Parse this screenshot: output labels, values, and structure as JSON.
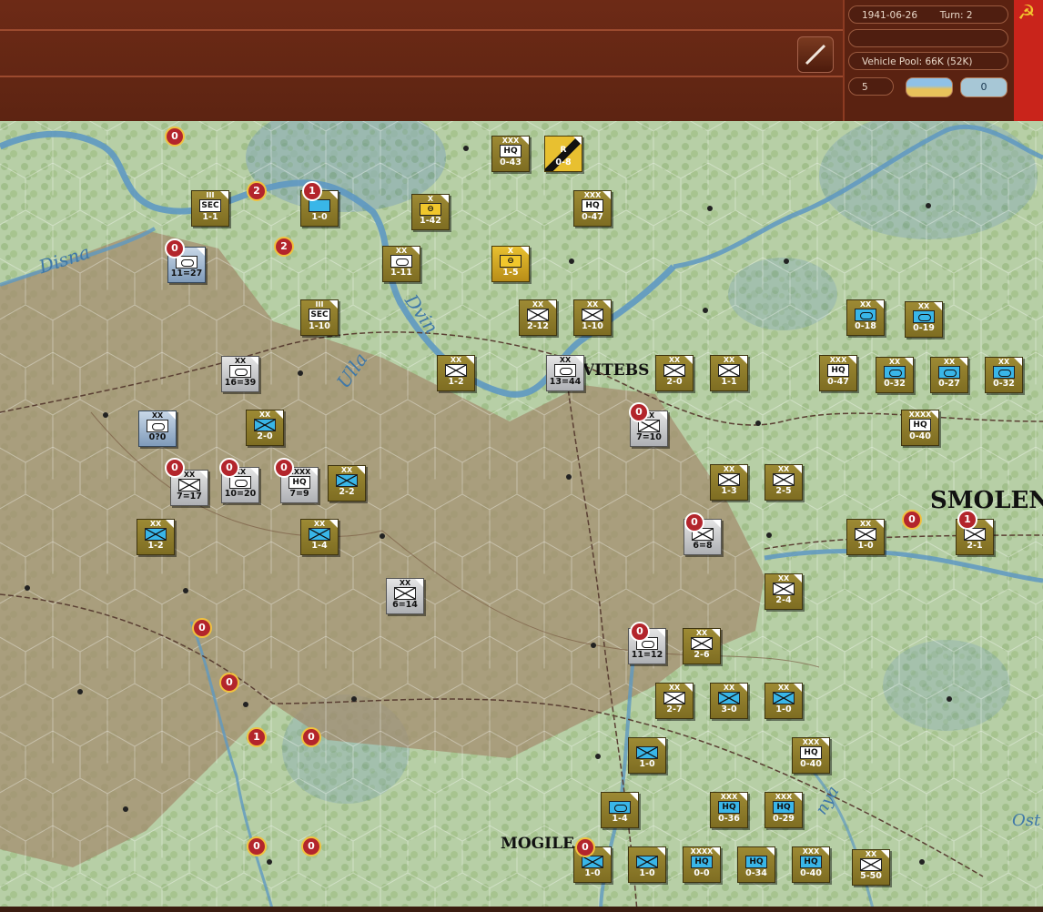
{
  "header": {
    "date": "1941-06-26",
    "turn": "Turn: 2",
    "vehicle_pool": "Vehicle Pool: 66K (52K)",
    "box_value": "5",
    "toggle": "0",
    "empty_field": ""
  },
  "cities": [
    {
      "name": "VITEBS"
    },
    {
      "name": "SMOLEN"
    },
    {
      "name": "MOGILE"
    }
  ],
  "rivers": [
    {
      "name": "Disna"
    },
    {
      "name": "Ulla"
    },
    {
      "name": "Dvin"
    },
    {
      "name": "nya"
    },
    {
      "name": "Ost"
    }
  ],
  "units": [
    {
      "id": "hq-043",
      "side": "sov",
      "ech": "XXX",
      "sym": "HQ",
      "val": "0-43"
    },
    {
      "id": "rail-08",
      "side": "rail",
      "ech": "",
      "sym": "R",
      "val": "0-8"
    },
    {
      "id": "sec-11",
      "side": "sov",
      "ech": "III",
      "sym": "SEC",
      "val": "1-1"
    },
    {
      "id": "tank-10",
      "side": "sov",
      "ech": "",
      "sym": "",
      "val": "1-0"
    },
    {
      "id": "cav-142",
      "side": "sov",
      "ech": "X",
      "sym": "",
      "val": "1-42"
    },
    {
      "id": "hq-047a",
      "side": "sov",
      "ech": "XXX",
      "sym": "HQ",
      "val": "0-47"
    },
    {
      "id": "ax-1127",
      "side": "sel",
      "ech": "",
      "sym": "",
      "val": "11=27"
    },
    {
      "id": "arm-111",
      "side": "sov",
      "ech": "XX",
      "sym": "",
      "val": "1-11"
    },
    {
      "id": "cav-15",
      "side": "yel",
      "ech": "X",
      "sym": "",
      "val": "1-5"
    },
    {
      "id": "sec-110",
      "side": "sov",
      "ech": "III",
      "sym": "SEC",
      "val": "1-10"
    },
    {
      "id": "inf-212",
      "side": "sov",
      "ech": "XX",
      "sym": "",
      "val": "2-12"
    },
    {
      "id": "inf-110",
      "side": "sov",
      "ech": "XX",
      "sym": "",
      "val": "1-10"
    },
    {
      "id": "mot-018",
      "side": "sov",
      "ech": "XX",
      "sym": "",
      "val": "0-18"
    },
    {
      "id": "mot-019",
      "side": "sov",
      "ech": "XX",
      "sym": "",
      "val": "0-19"
    },
    {
      "id": "ax-1639",
      "side": "gr",
      "ech": "XX",
      "sym": "",
      "val": "16=39"
    },
    {
      "id": "inf-12",
      "side": "sov",
      "ech": "XX",
      "sym": "",
      "val": "1-2"
    },
    {
      "id": "ax-1344",
      "side": "gr",
      "ech": "XX",
      "sym": "",
      "val": "13=44"
    },
    {
      "id": "inf-20a",
      "side": "sov",
      "ech": "XX",
      "sym": "",
      "val": "2-0"
    },
    {
      "id": "inf-11",
      "side": "sov",
      "ech": "XX",
      "sym": "",
      "val": "1-1"
    },
    {
      "id": "hq-047b",
      "side": "sov",
      "ech": "XXX",
      "sym": "HQ",
      "val": "0-47"
    },
    {
      "id": "mot-032a",
      "side": "sov",
      "ech": "XX",
      "sym": "",
      "val": "0-32"
    },
    {
      "id": "mot-027",
      "side": "sov",
      "ech": "XX",
      "sym": "",
      "val": "0-27"
    },
    {
      "id": "mot-032b",
      "side": "sov",
      "ech": "XX",
      "sym": "",
      "val": "0-32"
    },
    {
      "id": "ax-020",
      "side": "sel",
      "ech": "XX",
      "sym": "",
      "val": "0?0"
    },
    {
      "id": "inf-20b",
      "side": "sov",
      "ech": "XX",
      "sym": "",
      "val": "2-0"
    },
    {
      "id": "ax-710a",
      "side": "gr",
      "ech": "XX",
      "sym": "",
      "val": "7=10"
    },
    {
      "id": "hq-040a",
      "side": "sov",
      "ech": "XXXX",
      "sym": "HQ",
      "val": "0-40"
    },
    {
      "id": "ax-717",
      "side": "gr",
      "ech": "XX",
      "sym": "",
      "val": "7=17"
    },
    {
      "id": "ax-1020",
      "side": "gr",
      "ech": "XX",
      "sym": "",
      "val": "10=20"
    },
    {
      "id": "ax-79",
      "side": "gr",
      "ech": "XXXX",
      "sym": "HQ",
      "val": "7=9"
    },
    {
      "id": "inf-22",
      "side": "sov",
      "ech": "XX",
      "sym": "",
      "val": "2-2"
    },
    {
      "id": "inf-13",
      "side": "sov",
      "ech": "XX",
      "sym": "",
      "val": "1-3"
    },
    {
      "id": "inf-25",
      "side": "sov",
      "ech": "XX",
      "sym": "",
      "val": "2-5"
    },
    {
      "id": "inf-12b",
      "side": "sov",
      "ech": "XX",
      "sym": "",
      "val": "1-2"
    },
    {
      "id": "inf-14",
      "side": "sov",
      "ech": "XX",
      "sym": "",
      "val": "1-4"
    },
    {
      "id": "ax-68",
      "side": "gr",
      "ech": "",
      "sym": "",
      "val": "6=8"
    },
    {
      "id": "inf-10a",
      "side": "sov",
      "ech": "XX",
      "sym": "",
      "val": "1-0"
    },
    {
      "id": "city-21",
      "side": "sov",
      "ech": "",
      "sym": "",
      "val": "2-1"
    },
    {
      "id": "ax-614",
      "side": "gr",
      "ech": "XX",
      "sym": "",
      "val": "6=14"
    },
    {
      "id": "inf-24",
      "side": "sov",
      "ech": "XX",
      "sym": "",
      "val": "2-4"
    },
    {
      "id": "ax-1112",
      "side": "gr",
      "ech": "",
      "sym": "",
      "val": "11=12"
    },
    {
      "id": "inf-26",
      "side": "sov",
      "ech": "XX",
      "sym": "",
      "val": "2-6"
    },
    {
      "id": "inf-27",
      "side": "sov",
      "ech": "XX",
      "sym": "",
      "val": "2-7"
    },
    {
      "id": "inf-30",
      "side": "sov",
      "ech": "XX",
      "sym": "",
      "val": "3-0"
    },
    {
      "id": "inf-10b",
      "side": "sov",
      "ech": "XX",
      "sym": "",
      "val": "1-0"
    },
    {
      "id": "inf-10c",
      "side": "sov",
      "ech": "",
      "sym": "",
      "val": "1-0"
    },
    {
      "id": "hq-040b",
      "side": "sov",
      "ech": "XXX",
      "sym": "HQ",
      "val": "0-40"
    },
    {
      "id": "mot-14",
      "side": "sov",
      "ech": "",
      "sym": "",
      "val": "1-4"
    },
    {
      "id": "hq-036",
      "side": "sov",
      "ech": "XXX",
      "sym": "HQ",
      "val": "0-36"
    },
    {
      "id": "hq-029",
      "side": "sov",
      "ech": "XXX",
      "sym": "HQ",
      "val": "0-29"
    },
    {
      "id": "inf-10d",
      "side": "sov",
      "ech": "",
      "sym": "",
      "val": "1-0"
    },
    {
      "id": "inf-10e",
      "side": "sov",
      "ech": "",
      "sym": "",
      "val": "1-0"
    },
    {
      "id": "hq-00",
      "side": "sov",
      "ech": "XXXX",
      "sym": "HQ",
      "val": "0-0"
    },
    {
      "id": "hq-034",
      "side": "sov",
      "ech": "",
      "sym": "HQ",
      "val": "0-34"
    },
    {
      "id": "hq-040c",
      "side": "sov",
      "ech": "XXX",
      "sym": "HQ",
      "val": "0-40"
    },
    {
      "id": "inf-550",
      "side": "sov",
      "ech": "XX",
      "sym": "",
      "val": "5-50"
    }
  ],
  "badges": [
    {
      "v": "0"
    },
    {
      "v": "2"
    },
    {
      "v": "1"
    },
    {
      "v": "2"
    },
    {
      "v": "0"
    },
    {
      "v": "0"
    },
    {
      "v": "0"
    },
    {
      "v": "0"
    },
    {
      "v": "0"
    },
    {
      "v": "0"
    },
    {
      "v": "0"
    },
    {
      "v": "1"
    },
    {
      "v": "0"
    },
    {
      "v": "0"
    },
    {
      "v": "1"
    },
    {
      "v": "0"
    },
    {
      "v": "0"
    },
    {
      "v": "0"
    },
    {
      "v": "0"
    },
    {
      "v": "0"
    },
    {
      "v": "1"
    }
  ]
}
